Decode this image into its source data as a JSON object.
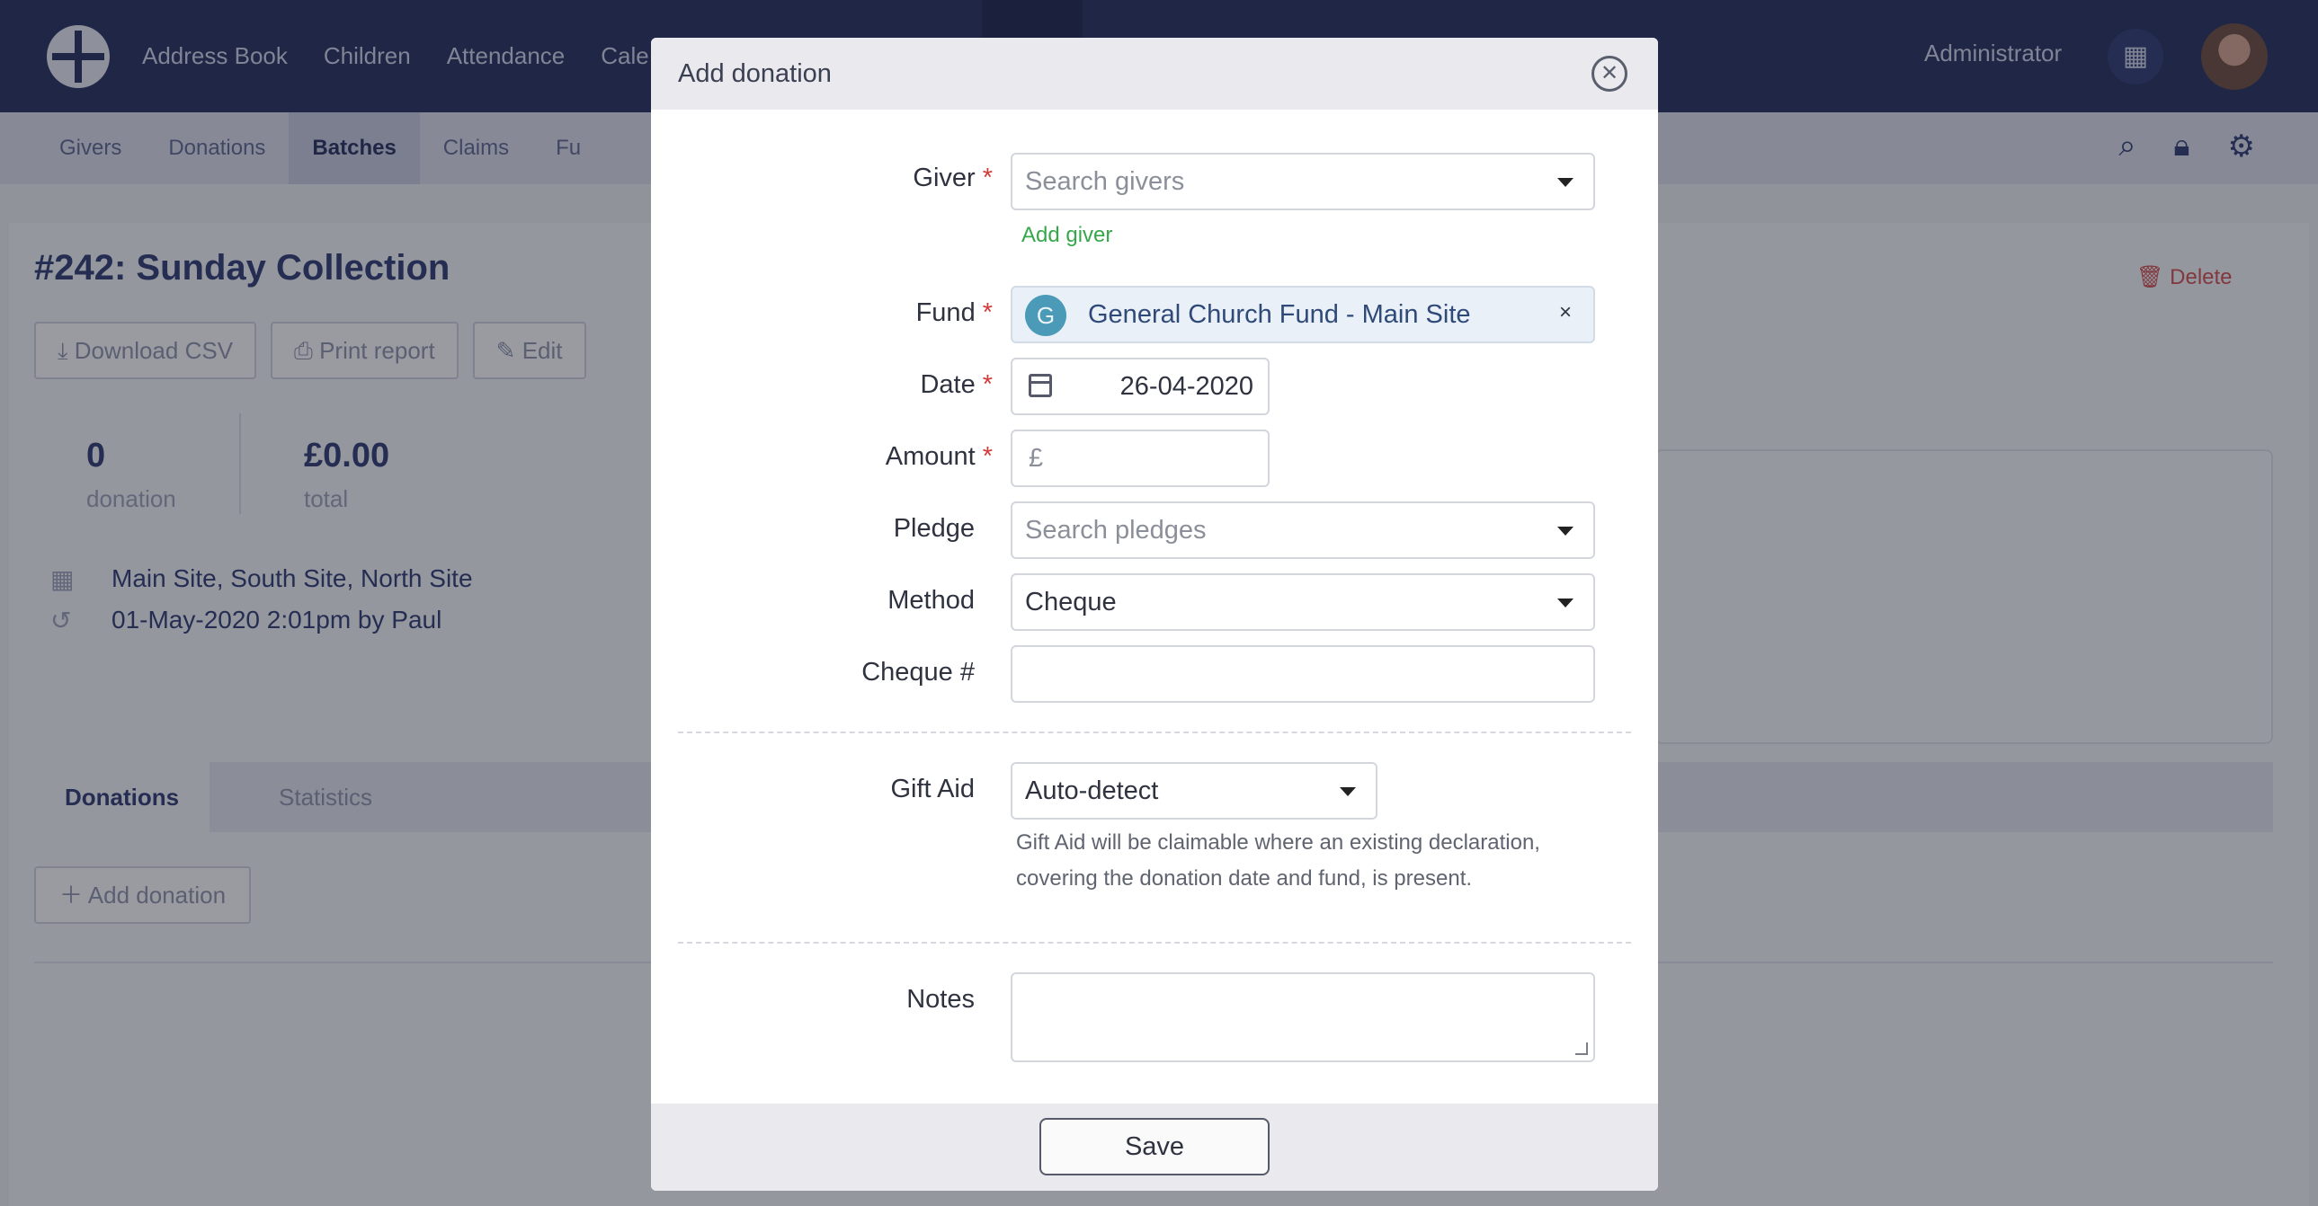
{
  "topnav": {
    "items": [
      "Address Book",
      "Children",
      "Attendance",
      "Cale"
    ],
    "user_label": "Administrator"
  },
  "subnav": {
    "tabs": [
      "Givers",
      "Donations",
      "Batches",
      "Claims",
      "Fu"
    ],
    "active_tab": "Batches"
  },
  "batch": {
    "title": "#242: Sunday Collection",
    "actions": [
      "Download CSV",
      "Print report",
      "Edit"
    ],
    "delete_label": "Delete",
    "stats": [
      {
        "value": "0",
        "label": "donation"
      },
      {
        "value": "£0.00",
        "label": "total"
      }
    ],
    "sites": "Main Site, South Site, North Site",
    "updated": "01-May-2020 2:01pm by Paul",
    "tabs": [
      "Donations",
      "Statistics"
    ],
    "add_donation_label": "Add donation"
  },
  "modal": {
    "title": "Add donation",
    "giver": {
      "label": "Giver",
      "placeholder": "Search givers",
      "add_link": "Add giver"
    },
    "fund": {
      "label": "Fund",
      "initial": "G",
      "value": "General Church Fund - Main Site",
      "remove": "×"
    },
    "date": {
      "label": "Date",
      "value": "26-04-2020"
    },
    "amount": {
      "label": "Amount",
      "currency": "£"
    },
    "pledge": {
      "label": "Pledge",
      "placeholder": "Search pledges"
    },
    "method": {
      "label": "Method",
      "value": "Cheque"
    },
    "cheque": {
      "label": "Cheque #",
      "value": ""
    },
    "gift_aid": {
      "label": "Gift Aid",
      "value": "Auto-detect",
      "help": "Gift Aid will be claimable where an existing declaration, covering the donation date and fund, is present."
    },
    "notes": {
      "label": "Notes",
      "value": ""
    },
    "required_marker": "*",
    "save_label": "Save"
  },
  "colors": {
    "topbar": "#1f2b5a",
    "required": "#d33a3a",
    "add_link": "#36a84a",
    "fund_avatar": "#4a9ab8"
  }
}
